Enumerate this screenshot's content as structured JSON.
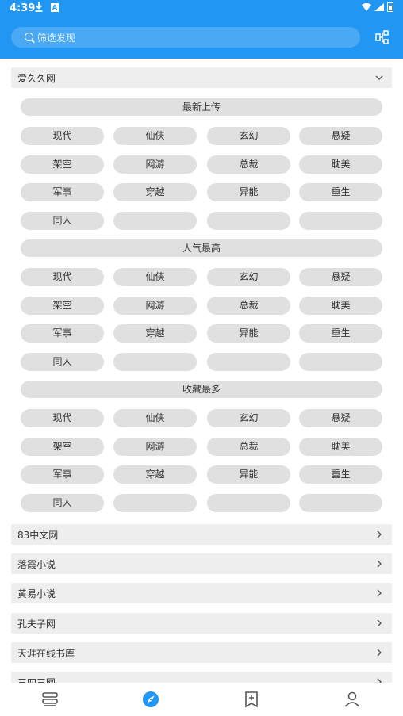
{
  "status": {
    "time": "4:39"
  },
  "search": {
    "placeholder": "筛选发现"
  },
  "expanded_group": {
    "title": "爱久久网",
    "sections": [
      {
        "title": "最新上传",
        "items": [
          "现代",
          "仙侠",
          "玄幻",
          "悬疑",
          "架空",
          "网游",
          "总裁",
          "耽美",
          "军事",
          "穿越",
          "异能",
          "重生",
          "同人",
          "",
          "",
          ""
        ]
      },
      {
        "title": "人气最高",
        "items": [
          "现代",
          "仙侠",
          "玄幻",
          "悬疑",
          "架空",
          "网游",
          "总裁",
          "耽美",
          "军事",
          "穿越",
          "异能",
          "重生",
          "同人",
          "",
          "",
          ""
        ]
      },
      {
        "title": "收藏最多",
        "items": [
          "现代",
          "仙侠",
          "玄幻",
          "悬疑",
          "架空",
          "网游",
          "总裁",
          "耽美",
          "军事",
          "穿越",
          "异能",
          "重生",
          "同人",
          "",
          "",
          ""
        ]
      }
    ]
  },
  "collapsed_groups": [
    "83中文网",
    "落霞小说",
    "黄易小说",
    "孔夫子网",
    "天涯在线书库",
    "三四三网"
  ],
  "nav": [
    "bookshelf-icon",
    "explore-icon",
    "bookmark-icon",
    "profile-icon"
  ],
  "colors": {
    "accent": "#2196f3",
    "chip": "#e0e0e0",
    "group_bg": "#eeeeee"
  }
}
